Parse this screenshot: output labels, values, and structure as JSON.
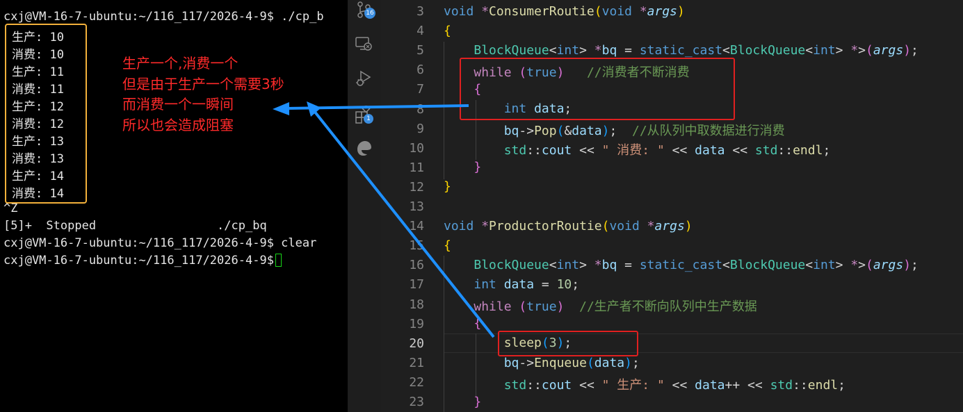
{
  "terminal": {
    "prompt": "cxj@VM-16-7-ubuntu:~/116_117/2026-4-9$",
    "command1": " ./cp_b",
    "output": [
      "生产: 10",
      "消费: 10",
      "生产: 11",
      "消费: 11",
      "生产: 12",
      "消费: 12",
      "生产: 13",
      "消费: 13",
      "生产: 14",
      "消费: 14"
    ],
    "ctrl_z": "^Z",
    "stopped_line": "[5]+  Stopped                 ./cp_bq",
    "command2": " clear"
  },
  "annotation": {
    "text": "生产一个,消费一个\n但是由于生产一个需要3秒\n而消费一个一瞬间\n所以也会造成阻塞",
    "color": "#ff2a2a"
  },
  "activity_bar": {
    "icons": [
      "source-control-icon",
      "remote-explorer-icon",
      "run-debug-icon",
      "extensions-icon",
      "edge-browser-icon"
    ],
    "source_control_badge": "16",
    "extensions_badge": "1"
  },
  "editor": {
    "line_numbers": [
      "3",
      "4",
      "5",
      "6",
      "7",
      "8",
      "9",
      "10",
      "11",
      "12",
      "13",
      "14",
      "15",
      "16",
      "17",
      "18",
      "19",
      "20",
      "21",
      "22",
      "23"
    ],
    "active_line": "20",
    "comments": {
      "consumer_loop": "//消费者不断消费",
      "consumer_pop": "//从队列中取数据进行消费",
      "producer_loop": "//生产者不断向队列中生产数据"
    },
    "strings": {
      "consume": "\" 消费: \"",
      "produce": "\" 生产: \""
    }
  },
  "colors": {
    "terminal_bg": "#000000",
    "editor_bg": "#1f1f1f",
    "highlight_box_yellow": "#f3b13b",
    "highlight_box_red": "#e02020",
    "arrow_blue": "#1e90ff"
  }
}
